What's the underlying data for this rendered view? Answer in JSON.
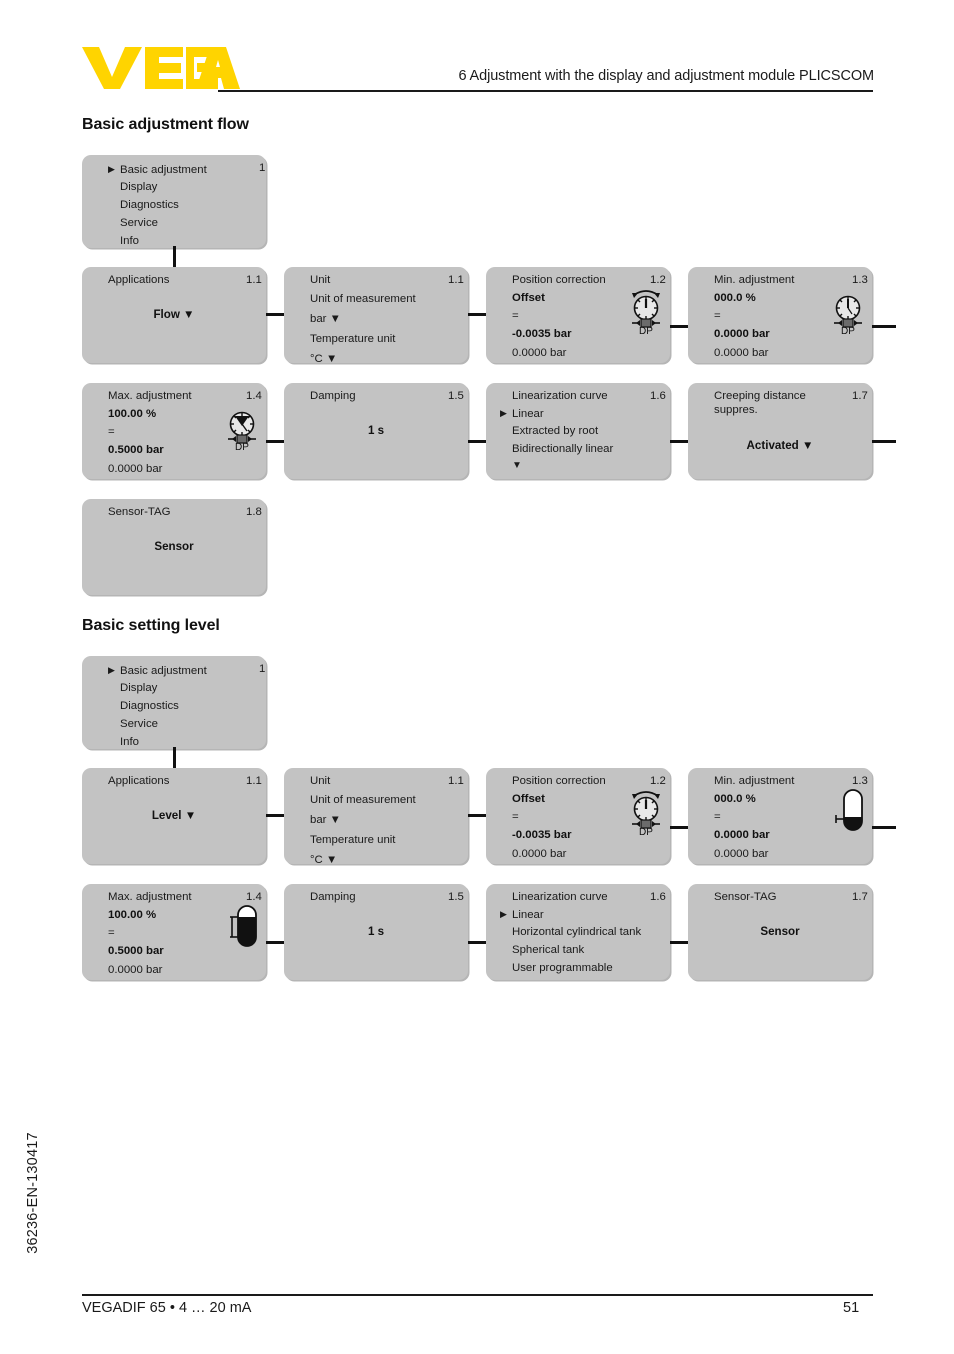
{
  "header": {
    "logo_text": "VEGA",
    "logo_color": "#FFD400",
    "chapter_title": "6 Adjustment with the display and adjustment module PLICSCOM"
  },
  "footer": {
    "doc_code": "36236-EN-130417",
    "product": "VEGADIF 65 • 4 … 20 mA",
    "page_number": "51"
  },
  "sections": [
    {
      "id": "flow",
      "heading": "Basic adjustment flow"
    },
    {
      "id": "level",
      "heading": "Basic setting level"
    }
  ],
  "flow": {
    "menu": {
      "number": "1",
      "items": [
        {
          "marker": "▶",
          "label": "Basic adjustment"
        },
        {
          "marker": "",
          "label": "Display"
        },
        {
          "marker": "",
          "label": "Diagnostics"
        },
        {
          "marker": "",
          "label": "Service"
        },
        {
          "marker": "",
          "label": "Info"
        }
      ]
    },
    "applications": {
      "number": "1.1",
      "title": "Applications",
      "value": "Flow ▼"
    },
    "unit": {
      "number": "1.1",
      "title": "Unit",
      "lines": [
        "Unit of measurement",
        "bar ▼",
        "Temperature unit",
        "°C ▼"
      ]
    },
    "position_correction": {
      "number": "1.2",
      "title": "Position correction",
      "line1": "Offset",
      "line2": "=",
      "line3": "-0.0035 bar",
      "line4": "0.0000 bar",
      "icon": "dp-gauge-icon",
      "icon_label": "DP"
    },
    "min_adjustment": {
      "number": "1.3",
      "title": "Min. adjustment",
      "line1": "000.0 %",
      "line2": "=",
      "line3": "0.0000 bar",
      "line4": "0.0000 bar",
      "icon": "dp-gauge-icon",
      "icon_label": "DP"
    },
    "max_adjustment": {
      "number": "1.4",
      "title": "Max. adjustment",
      "line1": "100.00 %",
      "line2": "=",
      "line3": "0.5000 bar",
      "line4": "0.0000 bar",
      "icon": "dp-gauge-max-icon",
      "icon_label": "DP"
    },
    "damping": {
      "number": "1.5",
      "title": "Damping",
      "value": "1 s"
    },
    "linearization": {
      "number": "1.6",
      "title": "Linearization curve",
      "items": [
        {
          "marker": "▶",
          "label": "Linear"
        },
        {
          "marker": "",
          "label": "Extracted by root"
        },
        {
          "marker": "",
          "label": "Bidirectionally linear"
        },
        {
          "marker": "",
          "label": "▼"
        }
      ]
    },
    "creeping": {
      "number": "1.7",
      "title": "Creeping distance\nsuppres.",
      "value": "Activated ▼"
    },
    "sensor_tag": {
      "number": "1.8",
      "title": "Sensor-TAG",
      "value": "Sensor"
    }
  },
  "level": {
    "menu": {
      "number": "1",
      "items": [
        {
          "marker": "▶",
          "label": "Basic adjustment"
        },
        {
          "marker": "",
          "label": "Display"
        },
        {
          "marker": "",
          "label": "Diagnostics"
        },
        {
          "marker": "",
          "label": "Service"
        },
        {
          "marker": "",
          "label": "Info"
        }
      ]
    },
    "applications": {
      "number": "1.1",
      "title": "Applications",
      "value": "Level ▼"
    },
    "unit": {
      "number": "1.1",
      "title": "Unit",
      "lines": [
        "Unit of measurement",
        "bar ▼",
        "Temperature unit",
        "°C ▼"
      ]
    },
    "position_correction": {
      "number": "1.2",
      "title": "Position correction",
      "line1": "Offset",
      "line2": "=",
      "line3": "-0.0035 bar",
      "line4": "0.0000 bar",
      "icon": "dp-gauge-icon",
      "icon_label": "DP"
    },
    "min_adjustment": {
      "number": "1.3",
      "title": "Min. adjustment",
      "line1": "000.0 %",
      "line2": "=",
      "line3": "0.0000 bar",
      "line4": "0.0000 bar",
      "icon": "tank-level-min-icon"
    },
    "max_adjustment": {
      "number": "1.4",
      "title": "Max. adjustment",
      "line1": "100.00 %",
      "line2": "=",
      "line3": "0.5000 bar",
      "line4": "0.0000 bar",
      "icon": "tank-level-max-icon"
    },
    "damping": {
      "number": "1.5",
      "title": "Damping",
      "value": "1 s"
    },
    "linearization": {
      "number": "1.6",
      "title": "Linearization curve",
      "items": [
        {
          "marker": "▶",
          "label": "Linear"
        },
        {
          "marker": "",
          "label": "Horizontal cylindrical tank"
        },
        {
          "marker": "",
          "label": "Spherical tank"
        },
        {
          "marker": "",
          "label": "User programmable"
        }
      ]
    },
    "sensor_tag": {
      "number": "1.7",
      "title": "Sensor-TAG",
      "value": "Sensor"
    }
  },
  "colors": {
    "box_fill": "#c3c3c3",
    "ink": "#1a1a1a",
    "brand_yellow": "#FFD400"
  }
}
